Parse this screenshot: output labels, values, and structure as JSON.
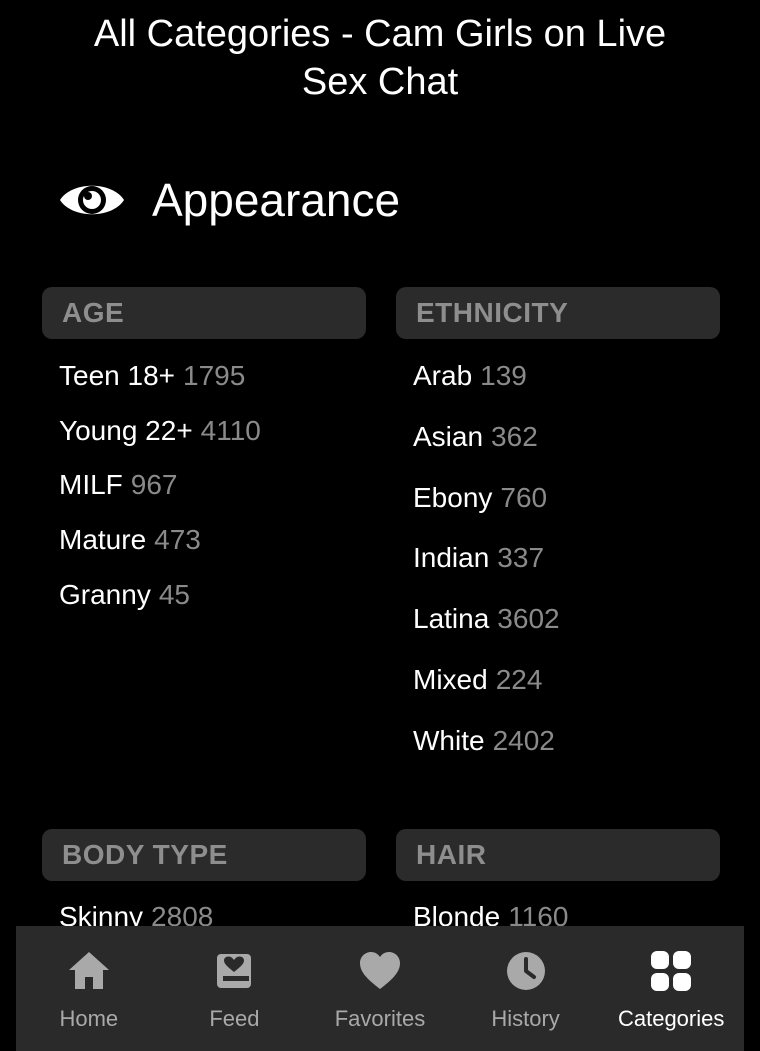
{
  "page": {
    "title": "All Categories - Cam Girls on Live Sex Chat"
  },
  "section": {
    "title": "Appearance",
    "icon": "eye-icon"
  },
  "categories": {
    "age": {
      "label": "AGE",
      "items": [
        {
          "label": "Teen 18+",
          "count": "1795"
        },
        {
          "label": "Young 22+",
          "count": "4110"
        },
        {
          "label": "MILF",
          "count": "967"
        },
        {
          "label": "Mature",
          "count": "473"
        },
        {
          "label": "Granny",
          "count": "45"
        }
      ]
    },
    "ethnicity": {
      "label": "ETHNICITY",
      "items": [
        {
          "label": "Arab",
          "count": "139"
        },
        {
          "label": "Asian",
          "count": "362"
        },
        {
          "label": "Ebony",
          "count": "760"
        },
        {
          "label": "Indian",
          "count": "337"
        },
        {
          "label": "Latina",
          "count": "3602"
        },
        {
          "label": "Mixed",
          "count": "224"
        },
        {
          "label": "White",
          "count": "2402"
        }
      ]
    },
    "body_type": {
      "label": "BODY TYPE",
      "items": [
        {
          "label": "Skinny",
          "count": "2808"
        }
      ]
    },
    "hair": {
      "label": "HAIR",
      "items": [
        {
          "label": "Blonde",
          "count": "1160"
        }
      ]
    }
  },
  "nav": {
    "items": [
      {
        "label": "Home",
        "icon": "home-icon",
        "active": false
      },
      {
        "label": "Feed",
        "icon": "feed-icon",
        "active": false
      },
      {
        "label": "Favorites",
        "icon": "heart-icon",
        "active": false
      },
      {
        "label": "History",
        "icon": "clock-icon",
        "active": false
      },
      {
        "label": "Categories",
        "icon": "grid-icon",
        "active": true
      }
    ]
  },
  "colors": {
    "background": "#000000",
    "header_bg": "#2b2b2b",
    "header_text": "#8e8e8e",
    "count_text": "#8a8a8a",
    "nav_bg": "#2a2a2a",
    "nav_inactive": "#a9a9a9",
    "nav_active": "#ffffff"
  }
}
